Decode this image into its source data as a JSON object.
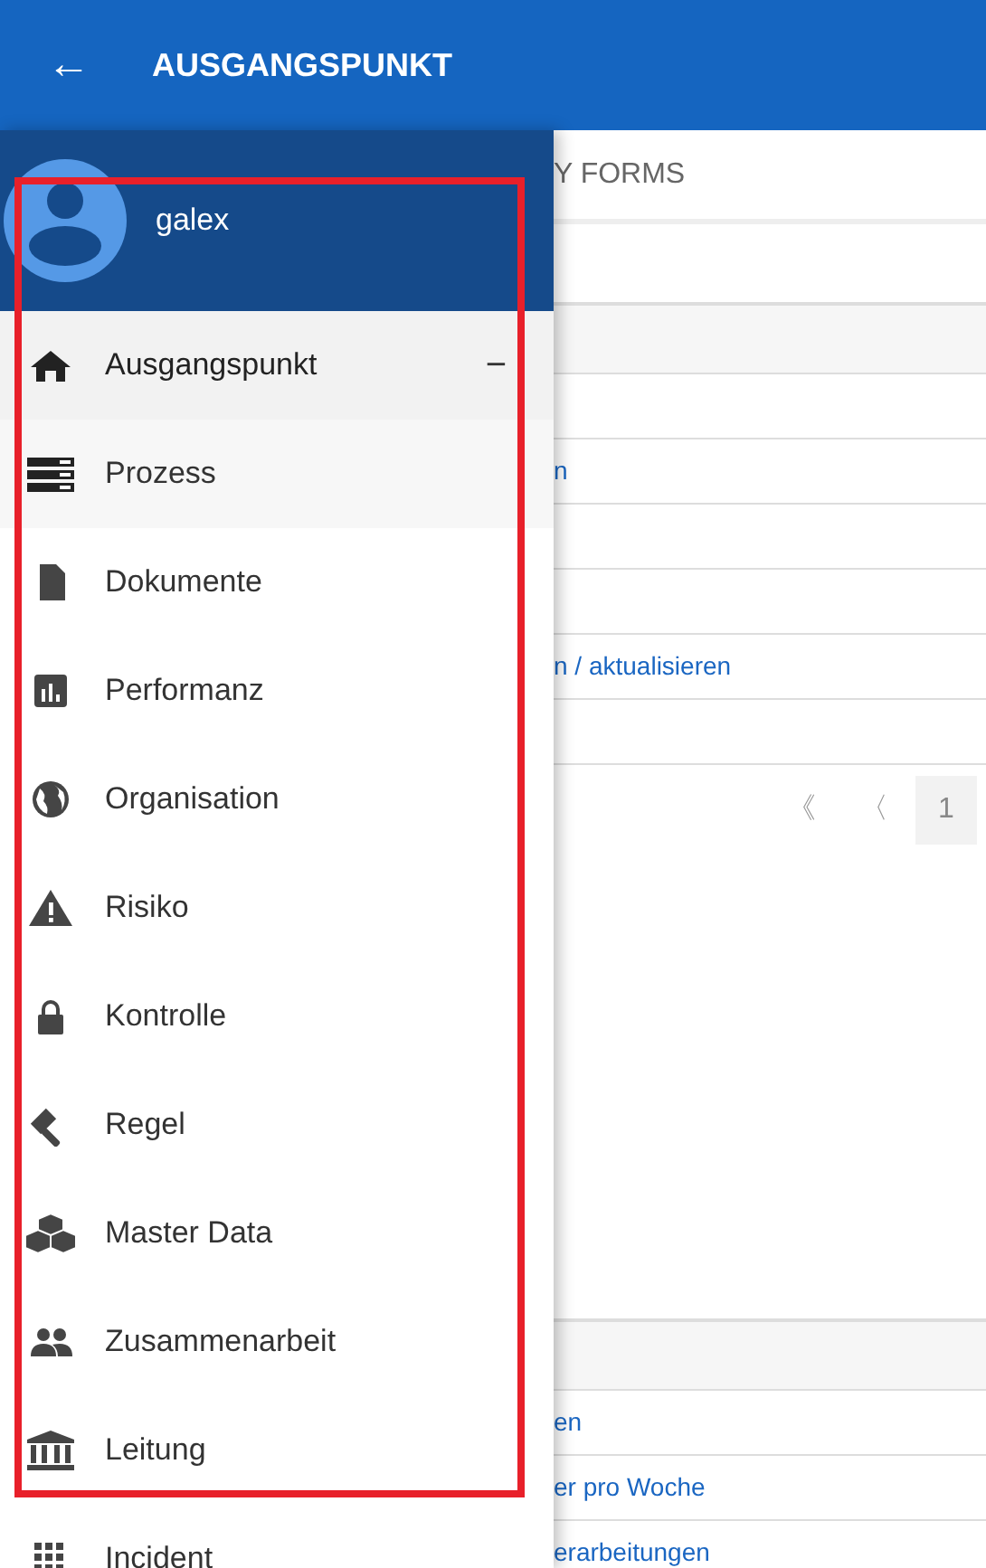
{
  "app_bar": {
    "back": "←",
    "title": "AUSGANGSPUNKT"
  },
  "drawer": {
    "user": "galex",
    "items": [
      {
        "label": "Ausgangspunkt",
        "selected": true,
        "expanded": true,
        "toggle": "−",
        "children": [
          {
            "label": "Prozess",
            "selected": false
          }
        ]
      },
      {
        "label": "Dokumente",
        "selected": false
      },
      {
        "label": "Performanz",
        "selected": false
      },
      {
        "label": "Organisation",
        "selected": false
      },
      {
        "label": "Risiko",
        "selected": false
      },
      {
        "label": "Kontrolle",
        "selected": false
      },
      {
        "label": "Regel",
        "selected": false
      },
      {
        "label": "Master Data",
        "selected": false
      },
      {
        "label": "Zusammenarbeit",
        "selected": false
      },
      {
        "label": "Leitung",
        "selected": false
      },
      {
        "label": "Incident",
        "selected": false
      }
    ]
  },
  "background": {
    "tab": "Y FORMS",
    "table_rows": [
      "",
      "n",
      "",
      "",
      "n / aktualisieren",
      ""
    ],
    "pagination": [
      "《",
      "〈",
      "1"
    ],
    "lower_rows": [
      "en",
      "er pro Woche",
      "erarbeitungen"
    ]
  }
}
